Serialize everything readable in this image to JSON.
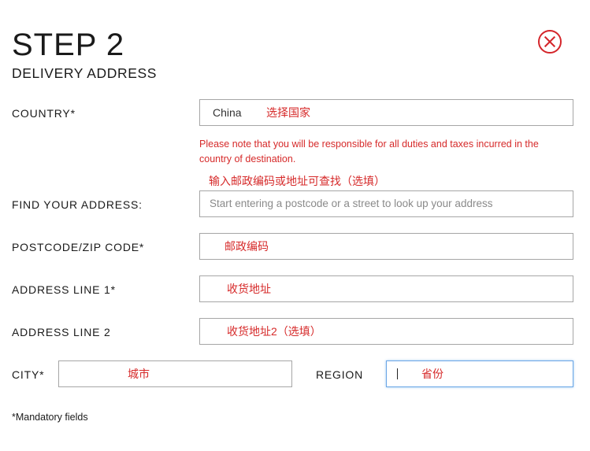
{
  "header": {
    "title": "STEP 2",
    "subtitle": "DELIVERY ADDRESS",
    "close_icon": "close-circle-icon"
  },
  "form": {
    "country": {
      "label": "COUNTRY*",
      "value": "China",
      "annotation": "选择国家"
    },
    "duties_note": "Please note that you will be responsible for all duties and taxes incurred in the country of destination.",
    "find_address": {
      "annotation": "输入邮政编码或地址可查找（选填）",
      "label": "FIND YOUR ADDRESS:",
      "placeholder": "Start entering a postcode or a street to look up your address"
    },
    "postcode": {
      "label": "POSTCODE/ZIP CODE*",
      "annotation": "邮政编码"
    },
    "address1": {
      "label": "ADDRESS LINE 1*",
      "annotation": "收货地址"
    },
    "address2": {
      "label": "ADDRESS LINE 2",
      "annotation": "收货地址2（选填）"
    },
    "city": {
      "label": "CITY*",
      "annotation": "城市"
    },
    "region": {
      "label": "REGION",
      "annotation": "省份"
    },
    "mandatory_note": "*Mandatory fields"
  },
  "colors": {
    "annotation_red": "#d62a2a",
    "focus_blue": "#6aa6e6",
    "border_gray": "#a6a6a6"
  }
}
